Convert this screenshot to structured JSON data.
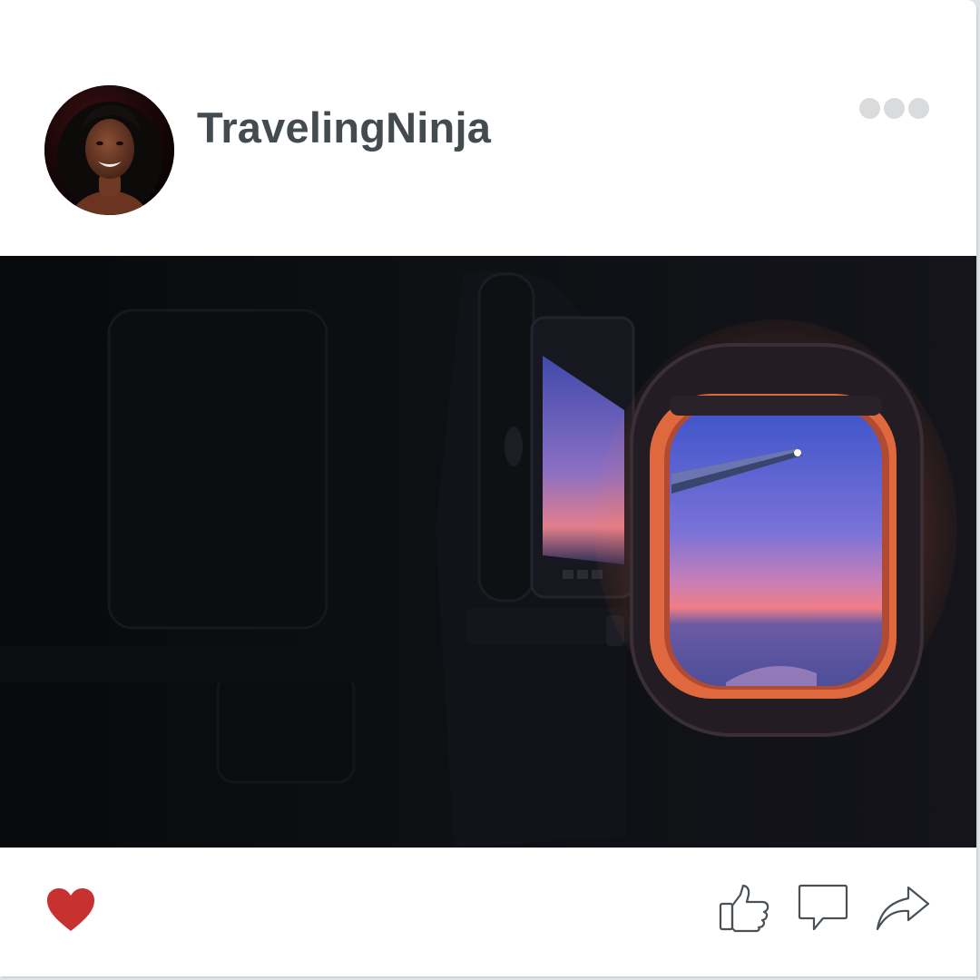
{
  "post": {
    "username": "TravelingNinja",
    "avatar_icon": "profile-photo",
    "image_icon": "airplane-window-sunset-photo"
  },
  "header": {
    "more_icon": "more-options-icon"
  },
  "actions": {
    "favorite_icon": "heart-icon",
    "like_icon": "thumbs-up-icon",
    "comment_icon": "comment-icon",
    "share_icon": "share-arrow-icon"
  },
  "colors": {
    "heart": "#c73230",
    "username": "#434b4e",
    "icon_stroke": "#4a5156",
    "more_dots": "#d9dbdc"
  }
}
